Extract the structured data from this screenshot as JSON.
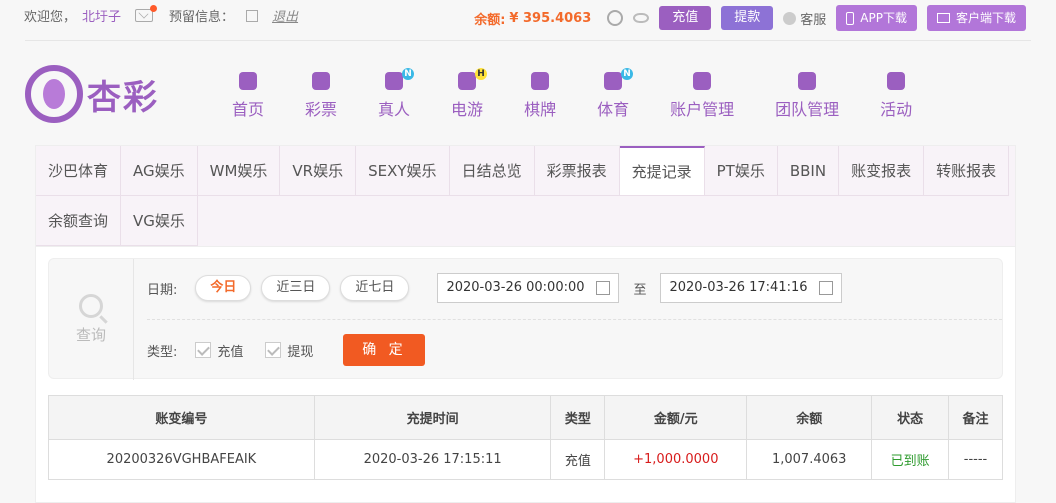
{
  "topbar": {
    "welcome": "欢迎您，",
    "username": "北圩子",
    "reserved_label": "预留信息：",
    "logout": "退出",
    "balance_label": "余额:",
    "balance_value": "¥ 395.4063",
    "recharge": "充值",
    "withdraw": "提款",
    "customer_service": "客服",
    "app_download": "APP下载",
    "client_download": "客户端下载"
  },
  "logo": {
    "text": "杏彩"
  },
  "nav": [
    {
      "label": "首页"
    },
    {
      "label": "彩票"
    },
    {
      "label": "真人",
      "badge": "N"
    },
    {
      "label": "电游",
      "badge": "H"
    },
    {
      "label": "棋牌"
    },
    {
      "label": "体育",
      "badge": "N"
    },
    {
      "label": "账户管理"
    },
    {
      "label": "团队管理"
    },
    {
      "label": "活动"
    }
  ],
  "tabs": [
    "沙巴体育",
    "AG娱乐",
    "WM娱乐",
    "VR娱乐",
    "SEXY娱乐",
    "日结总览",
    "彩票报表",
    "充提记录",
    "PT娱乐",
    "BBIN",
    "账变报表",
    "转账报表",
    "余额查询",
    "VG娱乐"
  ],
  "active_tab": "充提记录",
  "search": {
    "title": "查询",
    "date_label": "日期:",
    "quick_ranges": [
      "今日",
      "近三日",
      "近七日"
    ],
    "start": "2020-03-26 00:00:00",
    "to": "至",
    "end": "2020-03-26 17:41:16",
    "type_label": "类型:",
    "types": [
      "充值",
      "提现"
    ],
    "confirm": "确 定"
  },
  "table": {
    "headers": [
      "账变编号",
      "充提时间",
      "类型",
      "金额/元",
      "余额",
      "状态",
      "备注"
    ],
    "rows": [
      [
        "20200326VGHBAFEAIK",
        "2020-03-26 17:15:11",
        "充值",
        "+1,000.0000",
        "1,007.4063",
        "已到账",
        "-----"
      ]
    ]
  },
  "colors": {
    "brand": "#9b5fc0",
    "accent": "#f36a2b",
    "confirm": "#f15a22"
  }
}
